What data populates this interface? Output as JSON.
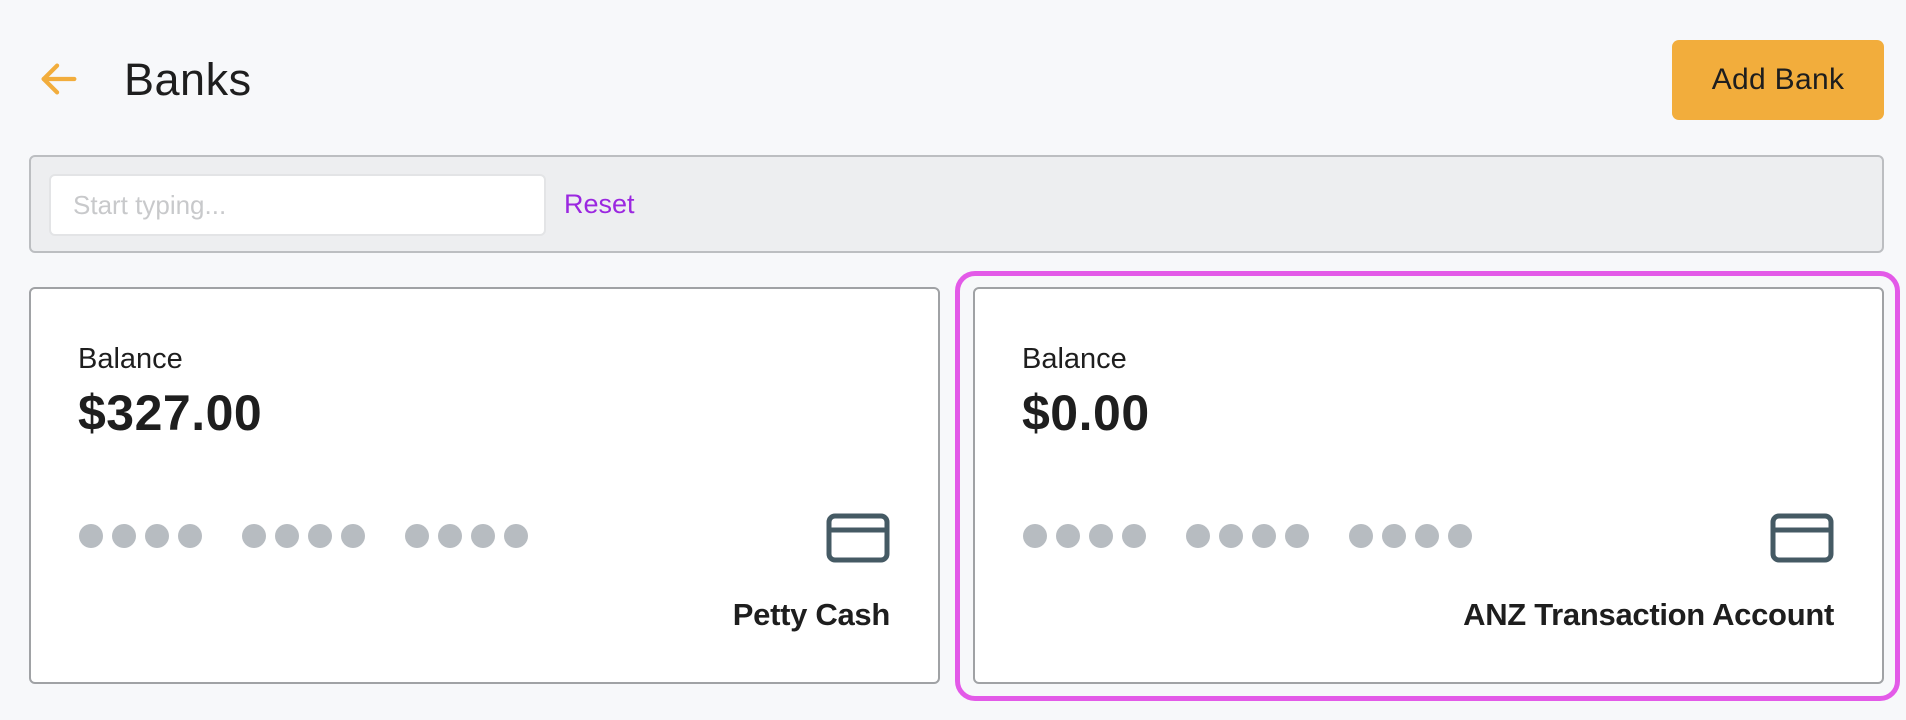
{
  "header": {
    "back_icon": "arrow-left-icon",
    "title": "Banks",
    "add_button_label": "Add Bank"
  },
  "filter": {
    "search_placeholder": "Start typing...",
    "search_value": "",
    "reset_label": "Reset"
  },
  "cards": [
    {
      "balance_label": "Balance",
      "balance": "$327.00",
      "masked_number": "•••• •••• ••••",
      "icon": "credit-card-icon",
      "name": "Petty Cash",
      "highlighted": false
    },
    {
      "balance_label": "Balance",
      "balance": "$0.00",
      "masked_number": "•••• •••• ••••",
      "icon": "credit-card-icon",
      "name": "ANZ Transaction Account",
      "highlighted": true
    }
  ],
  "colors": {
    "accent": "#f2ad3c",
    "link": "#9b27e0",
    "highlight": "#e35ae8",
    "icon": "#455a64",
    "mask_dot": "#b7bcc1",
    "background": "#f7f8fa"
  }
}
